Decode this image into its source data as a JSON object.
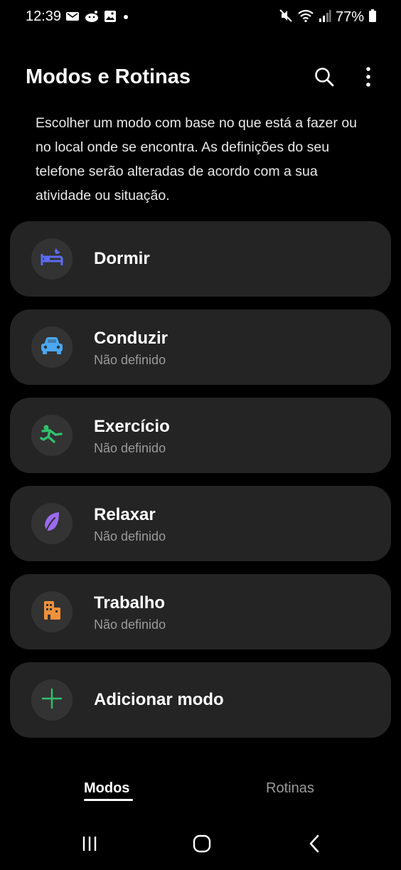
{
  "status_bar": {
    "time": "12:39",
    "battery_text": "77%",
    "left_icons": [
      "message-icon",
      "reddit-icon",
      "gallery-icon",
      "dot-icon"
    ],
    "right_icons": [
      "mute-icon",
      "wifi-icon",
      "signal-icon",
      "battery-icon"
    ]
  },
  "header": {
    "title": "Modos e Rotinas",
    "actions": [
      "search-icon",
      "more-options-icon"
    ]
  },
  "description": "Escolher um modo com base no que está a fazer ou no local onde se encontra. As definições do seu telefone serão alteradas de acordo com a sua atividade ou situação.",
  "modes": [
    {
      "title": "Dormir",
      "subtitle": "",
      "icon": "sleep-bed-icon",
      "color": "#5b6bf0"
    },
    {
      "title": "Conduzir",
      "subtitle": "Não definido",
      "icon": "car-icon",
      "color": "#4aa7f2"
    },
    {
      "title": "Exercício",
      "subtitle": "Não definido",
      "icon": "running-icon",
      "color": "#2ec26e"
    },
    {
      "title": "Relaxar",
      "subtitle": "Não definido",
      "icon": "leaf-icon",
      "color": "#9b6bf0"
    },
    {
      "title": "Trabalho",
      "subtitle": "Não definido",
      "icon": "building-icon",
      "color": "#f0913a"
    }
  ],
  "add_mode": {
    "title": "Adicionar modo",
    "icon": "plus-icon",
    "color": "#2ec26e"
  },
  "tabs": {
    "modos": "Modos",
    "rotinas": "Rotinas",
    "selected": "Modos"
  },
  "nav": [
    "recent-apps-icon",
    "home-icon",
    "back-icon"
  ]
}
